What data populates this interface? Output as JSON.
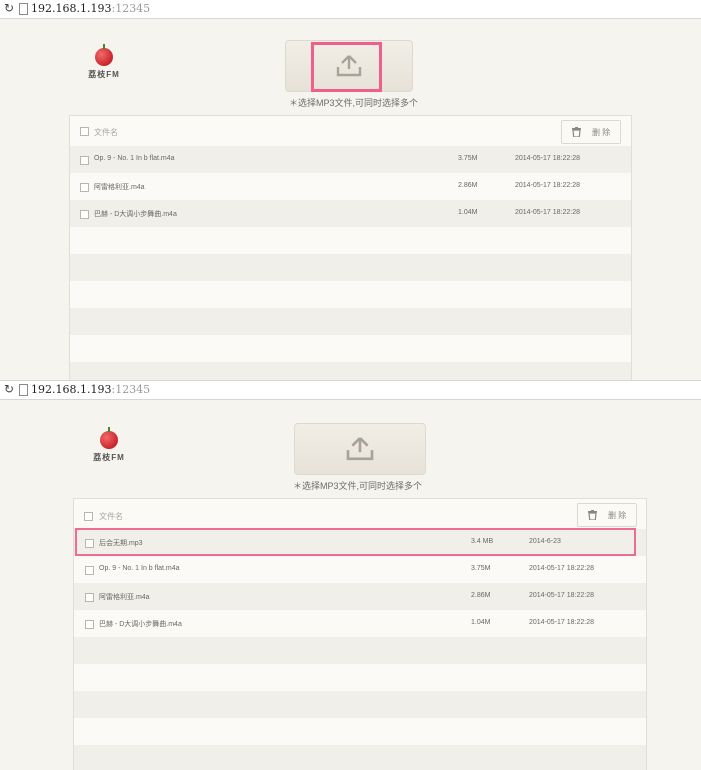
{
  "colors": {
    "highlight": "#ee5f8c",
    "page_background": "#f6f4ee",
    "row_alt": "#f1efea"
  },
  "icons": {
    "reload": "reload-icon",
    "page": "page-icon",
    "upload": "upload-icon",
    "trash": "trash-icon",
    "logo": "lychee-logo"
  },
  "screens": [
    {
      "url_host": "192.168.1.193",
      "url_port": ":12345",
      "logo_text": "荔枝FM",
      "upload_hint": "＊选择MP3文件,可同时选择多个",
      "header_label": "文件名",
      "delete_label": "删 除",
      "files": [
        {
          "name": "Op. 9 - No. 1 In b flat.m4a",
          "size": "3.75M",
          "date": "2014-05-17 18:22:28"
        },
        {
          "name": "阿雷格利亚.m4a",
          "size": "2.86M",
          "date": "2014-05-17 18:22:28"
        },
        {
          "name": "巴赫 - D大调小步舞曲.m4a",
          "size": "1.04M",
          "date": "2014-05-17 18:22:28"
        }
      ]
    },
    {
      "url_host": "192.168.1.193",
      "url_port": ":12345",
      "logo_text": "荔枝FM",
      "upload_hint": "＊选择MP3文件,可同时选择多个",
      "header_label": "文件名",
      "delete_label": "删 除",
      "files": [
        {
          "name": "后会无期.mp3",
          "size": "3.4 MB",
          "date": "2014-6-23"
        },
        {
          "name": "Op. 9 - No. 1 In b flat.m4a",
          "size": "3.75M",
          "date": "2014-05-17 18:22:28"
        },
        {
          "name": "阿雷格利亚.m4a",
          "size": "2.86M",
          "date": "2014-05-17 18:22:28"
        },
        {
          "name": "巴赫 - D大调小步舞曲.m4a",
          "size": "1.04M",
          "date": "2014-05-17 18:22:28"
        }
      ]
    }
  ]
}
